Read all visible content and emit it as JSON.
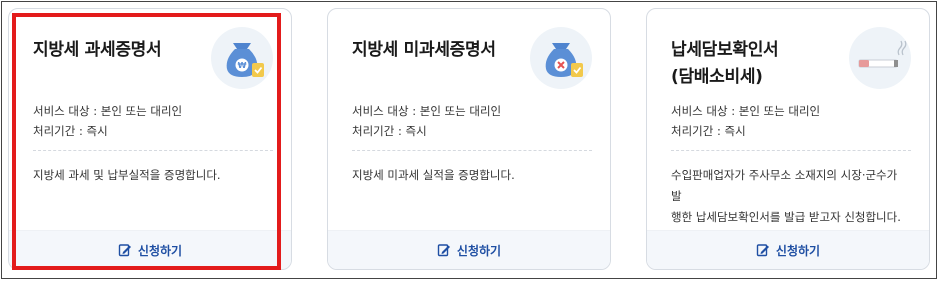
{
  "cards": [
    {
      "title": "지방세 과세증명서",
      "icon": "money-bag-check-icon",
      "meta1": "서비스 대상 : 본인 또는 대리인",
      "meta2": "처리기간 : 즉시",
      "desc": "지방세 과세 및 납부실적을 증명합니다.",
      "apply": "신청하기"
    },
    {
      "title": "지방세 미과세증명서",
      "icon": "money-bag-x-icon",
      "meta1": "서비스 대상 : 본인 또는 대리인",
      "meta2": "처리기간 : 즉시",
      "desc": "지방세 미과세 실적을 증명합니다.",
      "apply": "신청하기"
    },
    {
      "title1": "납세담보확인서",
      "title2": "(담배소비세)",
      "icon": "cigarette-icon",
      "meta1": "서비스 대상 : 본인 또는 대리인",
      "meta2": "처리기간 : 즉시",
      "desc1": "수입판매업자가 주사무소 소재지의 시장·군수가 발",
      "desc2": "행한 납세담보확인서를 발급 받고자 신청합니다.",
      "apply": "신청하기"
    }
  ],
  "colors": {
    "highlight": "#e31b1b",
    "accent": "#1f4fa3",
    "bag": "#5b8fd6"
  }
}
